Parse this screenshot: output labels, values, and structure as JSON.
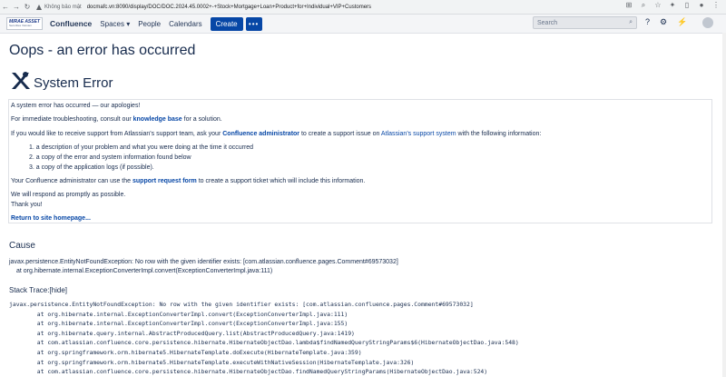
{
  "browser": {
    "back": "←",
    "forward": "→",
    "reload": "↻",
    "insecure_label": "Không bảo mật",
    "url": "docmafc.vn:8090/display/DOC/DOC.2024.45.0002+-+Stock+Mortgage+Loan+Product+for+Individual+VIP+Customers",
    "icons": [
      "translate-icon",
      "search-icon",
      "star-icon",
      "extensions-icon",
      "sidebar-icon",
      "profile-icon",
      "menu-icon"
    ]
  },
  "header": {
    "logo_text": "MIRAE ASSET",
    "logo_sub": "Securities Vietnam",
    "brand": "Confluence",
    "spaces": "Spaces",
    "people": "People",
    "calendars": "Calendars",
    "create": "Create",
    "more": "•••",
    "search_placeholder": "Search",
    "header_icons": [
      "help-icon",
      "settings-icon",
      "notifications-icon"
    ]
  },
  "page": {
    "title": "Oops - an error has occurred",
    "system_error": "System Error",
    "line1": "A system error has occurred — our apologies!",
    "line2_pre": "For immediate troubleshooting, consult our ",
    "line2_link": "knowledge base",
    "line2_post": " for a solution.",
    "line3_pre": "If you would like to receive support from Atlassian's support team, ask your ",
    "line3_link1": "Confluence administrator",
    "line3_mid": " to create a support issue on ",
    "line3_link2": "Atlassian's support system",
    "line3_post": " with the following information:",
    "list": [
      "1. a description of your problem and what you were doing at the time it occurred",
      "2. a copy of the error and system information found below",
      "3. a copy of the application logs (if possible)."
    ],
    "line4_pre": "Your Confluence administrator can use the ",
    "line4_link": "support request form",
    "line4_post": " to create a support ticket which will include this information.",
    "line5": "We will respond as promptly as possible.",
    "line6": "Thank you!",
    "return_link": "Return to site homepage..."
  },
  "cause": {
    "title": "Cause",
    "line1": "javax.persistence.EntityNotFoundException: No row with the given identifier exists: [com.atlassian.confluence.pages.Comment#69573032]",
    "line2": "at org.hibernate.internal.ExceptionConverterImpl.convert(ExceptionConverterImpl.java:111)"
  },
  "stack": {
    "title": "Stack Trace:[hide]",
    "lines": [
      "javax.persistence.EntityNotFoundException: No row with the given identifier exists: [com.atlassian.confluence.pages.Comment#69573032]",
      "        at org.hibernate.internal.ExceptionConverterImpl.convert(ExceptionConverterImpl.java:111)",
      "        at org.hibernate.internal.ExceptionConverterImpl.convert(ExceptionConverterImpl.java:155)",
      "        at org.hibernate.query.internal.AbstractProducedQuery.list(AbstractProducedQuery.java:1419)",
      "        at com.atlassian.confluence.core.persistence.hibernate.HibernateObjectDao.lambda$findNamedQueryStringParams$6(HibernateObjectDao.java:548)",
      "        at org.springframework.orm.hibernate5.HibernateTemplate.doExecute(HibernateTemplate.java:359)",
      "        at org.springframework.orm.hibernate5.HibernateTemplate.executeWithNativeSession(HibernateTemplate.java:326)",
      "        at com.atlassian.confluence.core.persistence.hibernate.HibernateObjectDao.findNamedQueryStringParams(HibernateObjectDao.java:524)"
    ]
  }
}
